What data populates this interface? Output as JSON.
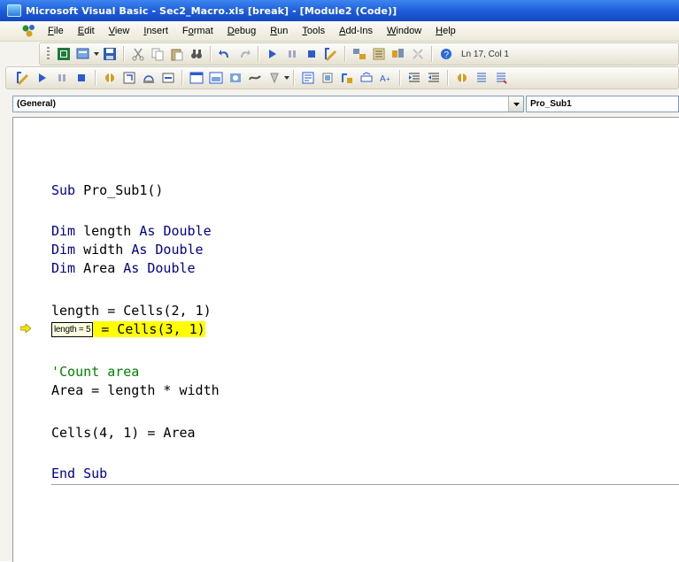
{
  "window": {
    "title": "Microsoft Visual Basic - Sec2_Macro.xls [break] - [Module2 (Code)]"
  },
  "menu": {
    "items": [
      {
        "label": "File",
        "ul": "F",
        "rest": "ile"
      },
      {
        "label": "Edit",
        "ul": "E",
        "rest": "dit"
      },
      {
        "label": "View",
        "ul": "V",
        "rest": "iew"
      },
      {
        "label": "Insert",
        "ul": "I",
        "rest": "nsert"
      },
      {
        "label": "Format",
        "ul": "o",
        "pre": "F",
        "rest": "rmat"
      },
      {
        "label": "Debug",
        "ul": "D",
        "rest": "ebug"
      },
      {
        "label": "Run",
        "ul": "R",
        "rest": "un"
      },
      {
        "label": "Tools",
        "ul": "T",
        "rest": "ools"
      },
      {
        "label": "Add-Ins",
        "ul": "A",
        "rest": "dd-Ins"
      },
      {
        "label": "Window",
        "ul": "W",
        "rest": "indow"
      },
      {
        "label": "Help",
        "ul": "H",
        "rest": "elp"
      }
    ]
  },
  "toolbar": {
    "position": "Ln 17, Col 1"
  },
  "combos": {
    "object": "(General)",
    "procedure": "Pro_Sub1"
  },
  "code": {
    "sub_kw": "Sub",
    "sub_name": " Pro_Sub1()",
    "dim_kw": "Dim",
    "as_kw": "As",
    "double_kw": "Double",
    "var1": " length ",
    "var2": " width ",
    "var3": " Area ",
    "line_assign1": "length = Cells(2, 1)",
    "tooltip": "length = 5",
    "line_assign2_rest": "= Cells(3, 1)",
    "comment": "'Count area",
    "line_area": "Area = length * width",
    "line_cells": "Cells(4, 1) = Area",
    "end_kw": "End Sub"
  },
  "colors": {
    "keyword": "#00008b",
    "comment": "#008000",
    "highlight": "#ffff00",
    "titlebar": "#1c5bd8"
  },
  "icons": [
    "app-icon",
    "vba-icon",
    "excel-icon",
    "insert-module-icon",
    "save-icon",
    "cut-icon",
    "copy-icon",
    "paste-icon",
    "find-icon",
    "undo-icon",
    "redo-icon",
    "run-icon",
    "break-icon",
    "reset-icon",
    "design-mode-icon",
    "project-explorer-icon",
    "properties-icon",
    "object-browser-icon",
    "toolbox-icon",
    "help-icon",
    "execution-arrow-icon"
  ]
}
